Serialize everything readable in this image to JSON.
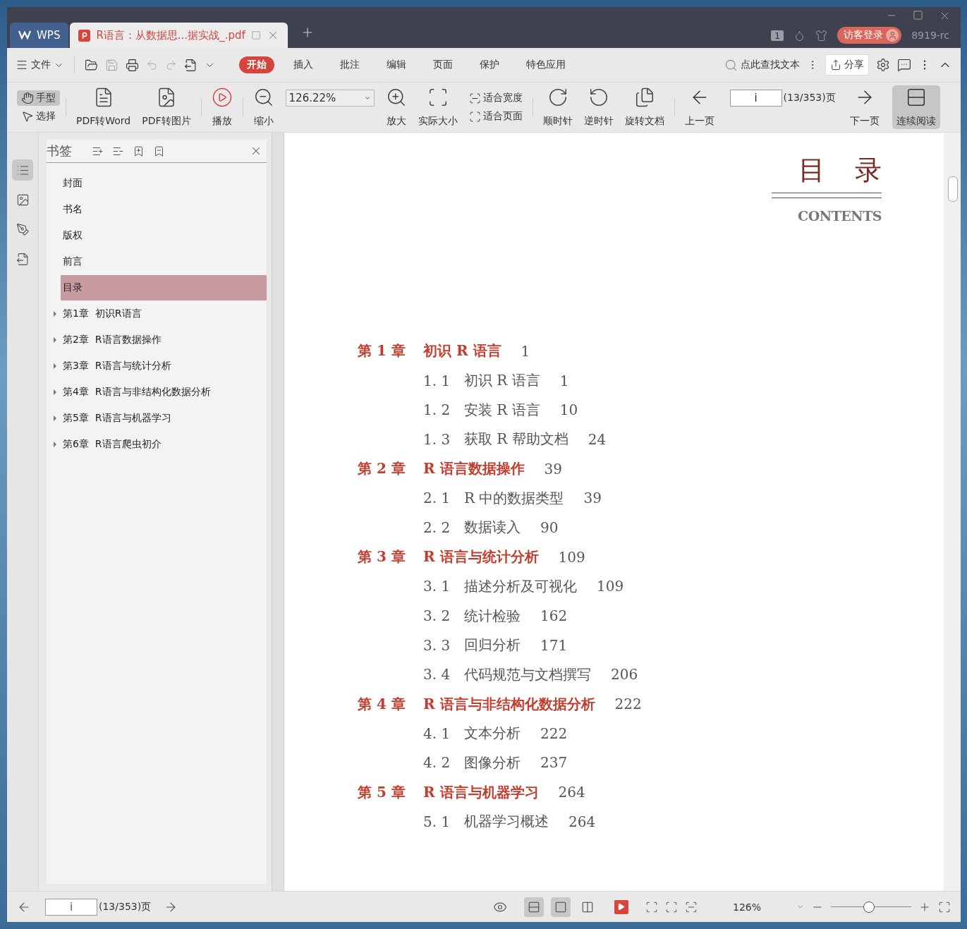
{
  "tabs": [
    {
      "kind": "home",
      "label": "WPS",
      "selected": false
    },
    {
      "kind": "doc",
      "label": "R语言：从数据思...据实战_.pdf",
      "selected": true
    }
  ],
  "title_bar": {
    "window_count": "1",
    "login": "访客登录",
    "user": "8919-rc"
  },
  "menu": {
    "file": "文件",
    "tabs": [
      {
        "label": "开始",
        "selected": true
      },
      {
        "label": "插入",
        "selected": false
      },
      {
        "label": "批注",
        "selected": false
      },
      {
        "label": "编辑",
        "selected": false
      },
      {
        "label": "页面",
        "selected": false
      },
      {
        "label": "保护",
        "selected": false
      },
      {
        "label": "特色应用",
        "selected": false
      }
    ],
    "search": {
      "placeholder": "点此查找文本"
    },
    "share": "分享"
  },
  "toolbar": {
    "modes": [
      {
        "label": "手型",
        "selected": true
      },
      {
        "label": "选择",
        "selected": false
      }
    ],
    "convert": [
      "PDF转Word",
      "PDF转图片",
      "播放",
      "缩小"
    ],
    "zoom_value": "126.22%",
    "zoom_buttons": [
      "放大",
      "实际大小"
    ],
    "fit": [
      "适合宽度",
      "适合页面"
    ],
    "rotate": [
      "顺时针",
      "逆时针",
      "旋转文档"
    ],
    "prev": "上一页",
    "page_value": "i",
    "page_count": "(13/353)页",
    "next": "下一页",
    "continuous": {
      "label": "连续阅读",
      "selected": true
    }
  },
  "side_tabs": [
    {
      "selected": true
    },
    {
      "selected": false
    },
    {
      "selected": false
    },
    {
      "selected": false
    }
  ],
  "bookmarks": {
    "title": "书签",
    "items": [
      {
        "label": "封面",
        "expandable": false,
        "selected": false
      },
      {
        "label": "书名",
        "expandable": false,
        "selected": false
      },
      {
        "label": "版权",
        "expandable": false,
        "selected": false
      },
      {
        "label": "前言",
        "expandable": false,
        "selected": false
      },
      {
        "label": "目录",
        "expandable": false,
        "selected": true
      },
      {
        "label": "第1章  初识R语言",
        "expandable": true,
        "selected": false
      },
      {
        "label": "第2章  R语言数据操作",
        "expandable": true,
        "selected": false
      },
      {
        "label": "第3章  R语言与统计分析",
        "expandable": true,
        "selected": false
      },
      {
        "label": "第4章  R语言与非结构化数据分析",
        "expandable": true,
        "selected": false
      },
      {
        "label": "第5章  R语言与机器学习",
        "expandable": true,
        "selected": false
      },
      {
        "label": "第6章  R语言爬虫初介",
        "expandable": true,
        "selected": false
      }
    ]
  },
  "document": {
    "heading": [
      "目",
      "录"
    ],
    "subtitle": "CONTENTS",
    "toc": [
      {
        "kind": "chapter",
        "number": "第 1 章",
        "title": "初识 R 语言",
        "page": "1"
      },
      {
        "kind": "section",
        "number": "1. 1",
        "title": "初识 R 语言",
        "page": "1"
      },
      {
        "kind": "section",
        "number": "1. 2",
        "title": "安装 R 语言",
        "page": "10"
      },
      {
        "kind": "section",
        "number": "1. 3",
        "title": "获取 R 帮助文档",
        "page": "24"
      },
      {
        "kind": "chapter",
        "number": "第 2 章",
        "title": "R 语言数据操作",
        "page": "39"
      },
      {
        "kind": "section",
        "number": "2. 1",
        "title": "R 中的数据类型",
        "page": "39"
      },
      {
        "kind": "section",
        "number": "2. 2",
        "title": "数据读入",
        "page": "90"
      },
      {
        "kind": "chapter",
        "number": "第 3 章",
        "title": "R 语言与统计分析",
        "page": "109"
      },
      {
        "kind": "section",
        "number": "3. 1",
        "title": "描述分析及可视化",
        "page": "109"
      },
      {
        "kind": "section",
        "number": "3. 2",
        "title": "统计检验",
        "page": "162"
      },
      {
        "kind": "section",
        "number": "3. 3",
        "title": "回归分析",
        "page": "171"
      },
      {
        "kind": "section",
        "number": "3. 4",
        "title": "代码规范与文档撰写",
        "page": "206"
      },
      {
        "kind": "chapter",
        "number": "第 4 章",
        "title": "R 语言与非结构化数据分析",
        "page": "222"
      },
      {
        "kind": "section",
        "number": "4. 1",
        "title": "文本分析",
        "page": "222"
      },
      {
        "kind": "section",
        "number": "4. 2",
        "title": "图像分析",
        "page": "237"
      },
      {
        "kind": "chapter",
        "number": "第 5 章",
        "title": "R 语言与机器学习",
        "page": "264"
      },
      {
        "kind": "section",
        "number": "5. 1",
        "title": "机器学习概述",
        "page": "264"
      }
    ]
  },
  "status_bar": {
    "page_value": "i",
    "page_count": "(13/353)页",
    "views": [
      {
        "selected": true
      },
      {
        "selected": true
      },
      {
        "selected": false
      }
    ],
    "zoom": "126%",
    "zoom_slider": {
      "level": 0.47
    }
  }
}
